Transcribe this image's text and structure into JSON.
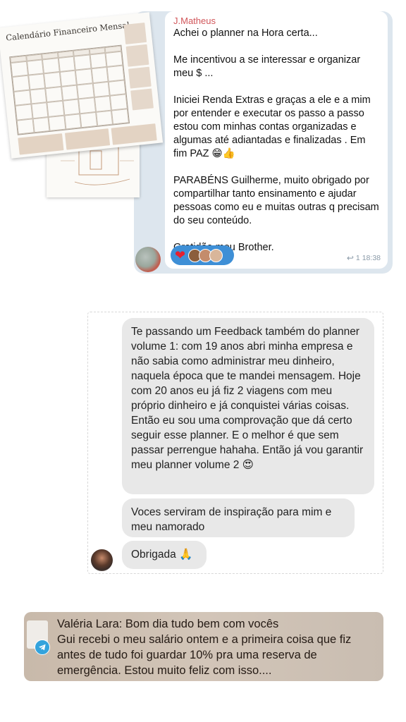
{
  "telegram_message": {
    "sender": "J.Matheus",
    "text": "Achei o planner  na Hora certa...\n\nMe incentivou a  se interessar  e organizar meu $ ...\n\nIniciei  Renda Extras   e graças a ele e a mim por entender e executar os passo a passo estou com minhas contas organizadas e algumas até adiantadas e finalizadas . Em fim PAZ 😁👍\n\nPARABÉNS Guilherme,  muito obrigado por compartilhar tanto ensinamento  e ajudar pessoas como eu e muitas outras q precisam do seu conteúdo.\n\nGratidão meu Brother.",
    "reaction_emoji": "❤",
    "reply_count": "1",
    "time": "18:38",
    "reply_icon": "reply-arrow-icon"
  },
  "attached_image": {
    "title": "Calendário Financeiro Mensal"
  },
  "chat_messages": {
    "messages": [
      "Te passando um Feedback também do planner volume 1: com 19 anos abri minha empresa e não sabia como administrar meu dinheiro, naquela época que te mandei mensagem. Hoje com 20 anos eu já fiz 2 viagens com meu próprio dinheiro e já conquistei várias coisas. Então eu sou uma comprovação que dá certo seguir esse planner. E o melhor é que sem passar perrengue hahaha. Então já vou garantir meu planner volume 2 😍",
      "Voces serviram de inspiração para mim e meu namorado",
      "Obrigada 🙏"
    ]
  },
  "notification": {
    "text": "Valéria Lara: Bom dia tudo bem com vocês\nGui recebi o meu salário ontem e a primeira coisa que fiz antes de tudo foi guardar 10% pra uma reserva de emergência. Estou muito feliz com isso....",
    "app_icon": "telegram-icon"
  }
}
